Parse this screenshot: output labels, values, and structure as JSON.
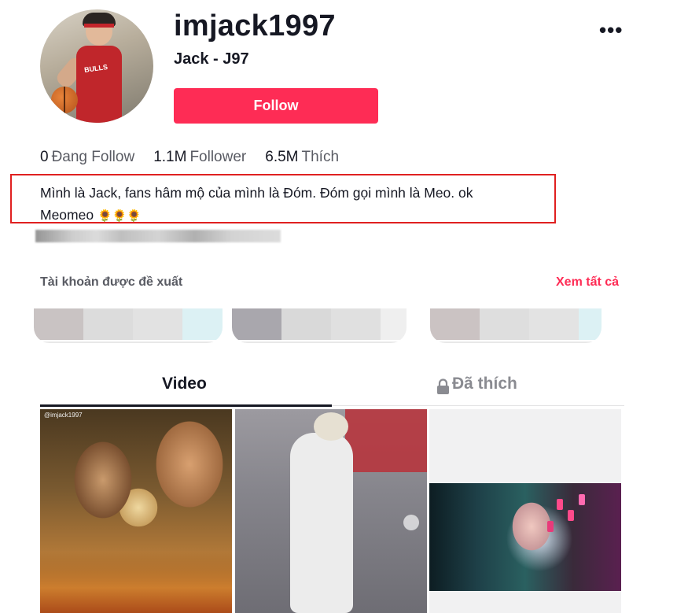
{
  "profile": {
    "username": "imjack1997",
    "nickname": "Jack - J97",
    "follow_label": "Follow",
    "more_label": "•••",
    "avatar_shirt_text": "BULLS",
    "stats": [
      {
        "value": "0",
        "label": "Đang Follow"
      },
      {
        "value": "1.1M",
        "label": "Follower"
      },
      {
        "value": "6.5M",
        "label": "Thích"
      }
    ],
    "bio_line1": "Mình là Jack, fans hâm mộ của mình là Đóm. Đóm gọi mình là Meo. ok",
    "bio_line2": "Meomeo",
    "bio_emoji": "🌻🌻🌻"
  },
  "suggested": {
    "title": "Tài khoản được đề xuất",
    "see_all": "Xem tất cả"
  },
  "tabs": [
    {
      "label": "Video",
      "active": true
    },
    {
      "label": "Đã thích",
      "active": false,
      "icon": "lock-icon"
    }
  ],
  "videos": [
    {
      "watermark": "@imjack1997"
    },
    {},
    {}
  ],
  "colors": {
    "accent": "#fe2c55",
    "highlight_box": "#e02020",
    "text_primary": "#161823",
    "text_secondary": "#595b63"
  }
}
